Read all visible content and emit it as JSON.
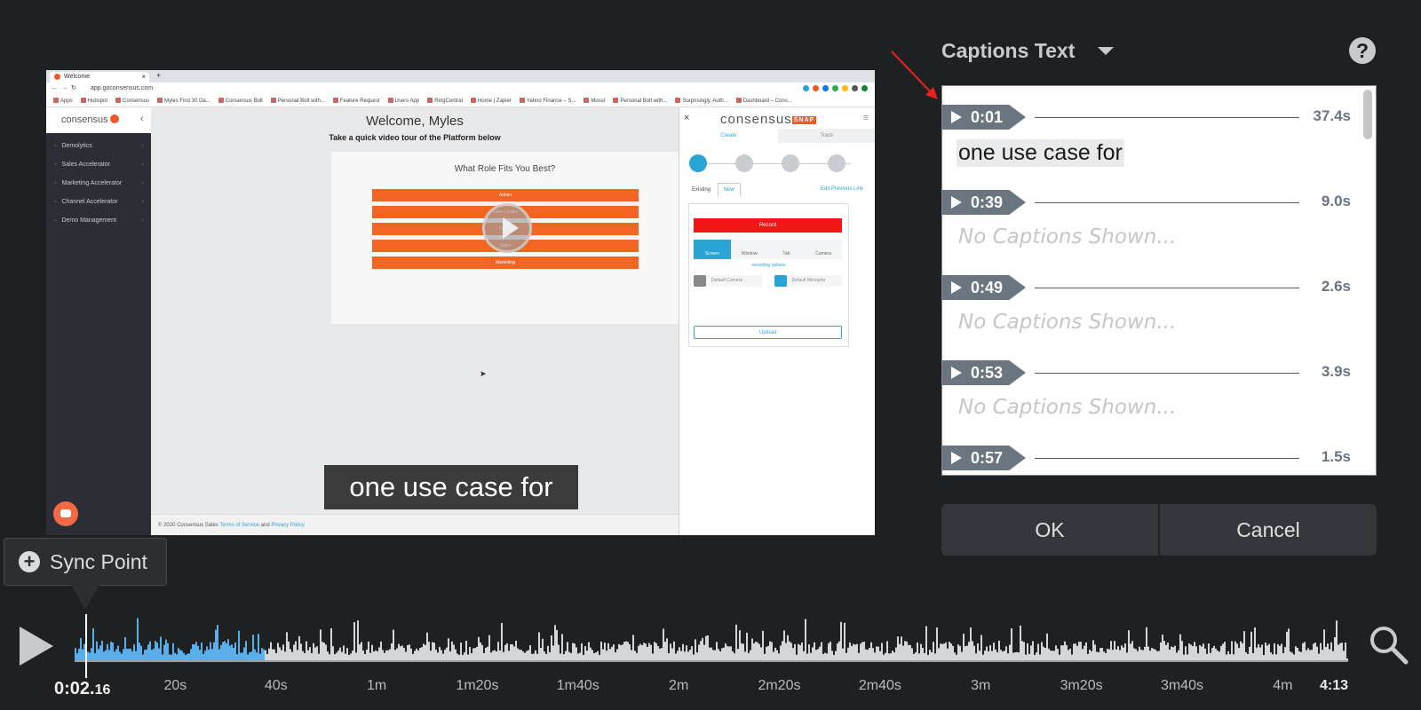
{
  "browser": {
    "tab_title": "Welcome",
    "url": "app.goconsensus.com",
    "bookmarks": [
      "Apps",
      "Hubspot",
      "Consensus",
      "Myles First 30 Da...",
      "Consensus Bolt",
      "Personal Bolt with...",
      "Feature Request",
      "Users App",
      "RingCentral",
      "Home | Zapier",
      "Yahoo Finance – S...",
      "Musst",
      "Personal Bolt with...",
      "Surprisingly, Auth...",
      "Dashboard – Cons..."
    ]
  },
  "app": {
    "logo": "consensus",
    "nav_items": [
      "Demolytics",
      "Sales Accelerator",
      "Marketing Accelerator",
      "Channel Accelerator",
      "Demo Management"
    ],
    "welcome": "Welcome, Myles",
    "tour_text": "Take a quick video tour of the Platform below",
    "role_question": "What Role Fits You Best?",
    "roles": [
      "Admin",
      "Sales Leader",
      "Demo",
      "Sales",
      "Marketing"
    ],
    "footer_prefix": "© 2020 Consensus Sales",
    "footer_terms": "Terms of Service",
    "footer_and": "and",
    "footer_privacy": "Privacy Policy"
  },
  "snap": {
    "brand": "consensus",
    "brand_badge": "SNAP",
    "tabs": [
      "Create",
      "Track"
    ],
    "sub_tabs": [
      "Existing",
      "New"
    ],
    "edit_link": "Edit Previous Link",
    "record": "Record",
    "modes": [
      "Screen",
      "Window",
      "Tab",
      "Camera"
    ],
    "recording_options": "recording options",
    "camera": "Default Camera",
    "microphone": "Default Micropho",
    "upload": "Upload"
  },
  "video_caption": "one use case for",
  "captions_panel": {
    "title": "Captions Text",
    "help": "?",
    "entries": [
      {
        "time": "0:01",
        "duration": "37.4s",
        "text": "one use case for"
      },
      {
        "time": "0:39",
        "duration": "9.0s",
        "text": "No Captions Shown..."
      },
      {
        "time": "0:49",
        "duration": "2.6s",
        "text": "No Captions Shown..."
      },
      {
        "time": "0:53",
        "duration": "3.9s",
        "text": "No Captions Shown..."
      },
      {
        "time": "0:57",
        "duration": "1.5s",
        "text": ""
      }
    ]
  },
  "buttons": {
    "ok": "OK",
    "cancel": "Cancel"
  },
  "sync_point": {
    "label": "Sync Point"
  },
  "timeline": {
    "current_time_main": "0:02.",
    "current_time_frac": "16",
    "ticks": [
      "20s",
      "40s",
      "1m",
      "1m20s",
      "1m40s",
      "2m",
      "2m20s",
      "2m40s",
      "3m",
      "3m20s",
      "3m40s",
      "4m",
      "4:13"
    ],
    "played_fraction": 0.05
  },
  "colors": {
    "background": "#1e2022",
    "waveform_played": "#5aaeea",
    "waveform_unplayed": "#d4d6d8",
    "caption_tag": "#6b7580",
    "pointer_arrow": "#e8231d"
  }
}
